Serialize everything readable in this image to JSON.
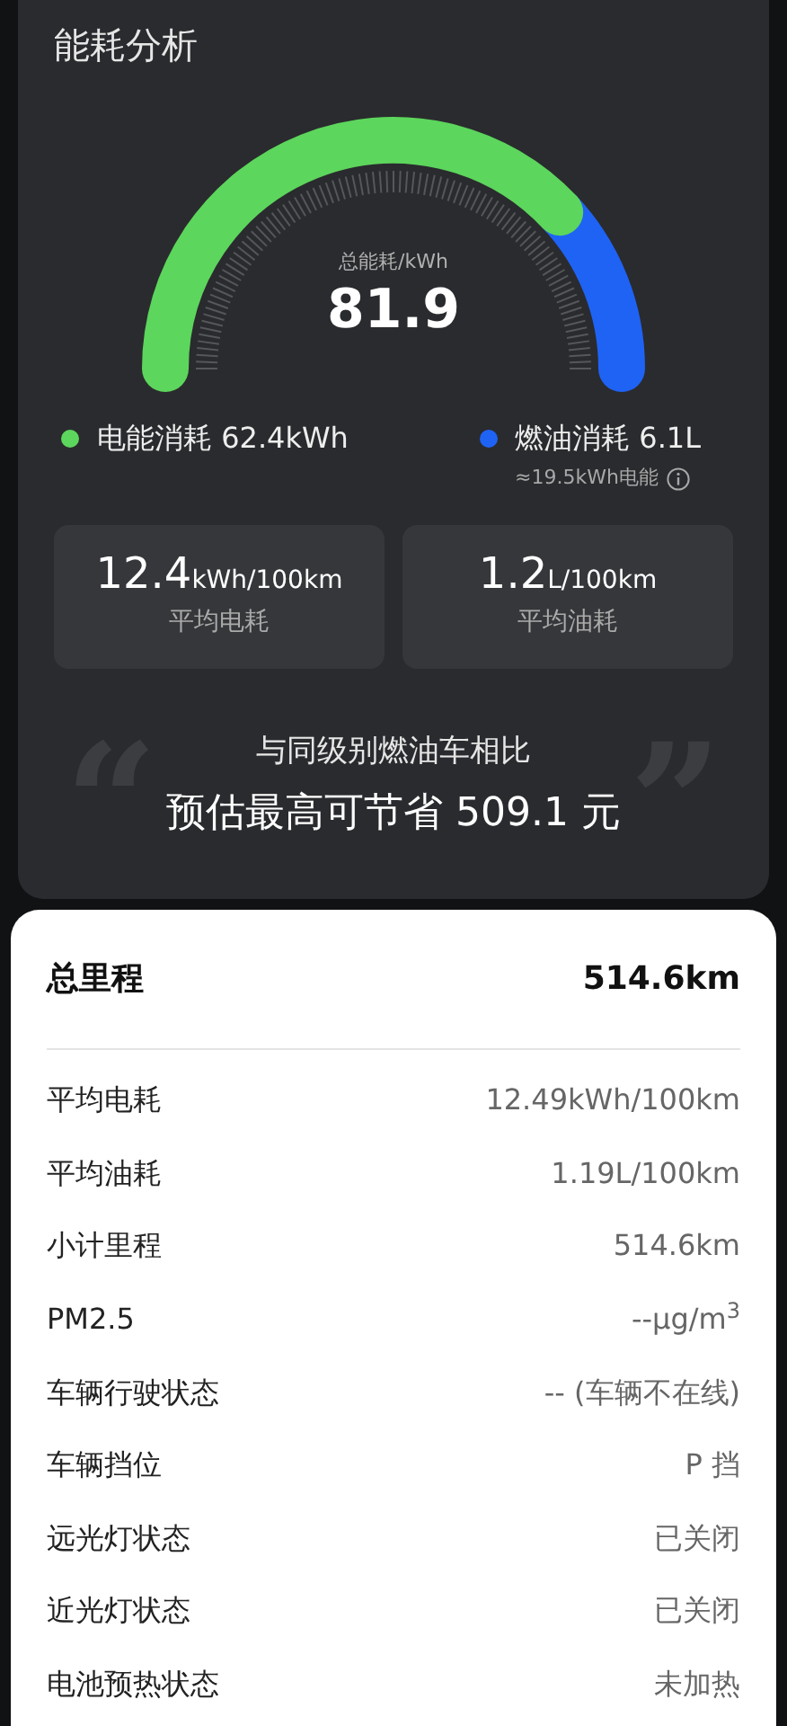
{
  "title": "能耗分析",
  "gauge": {
    "label": "总能耗/kWh",
    "value": "81.9"
  },
  "legend": [
    {
      "label": "电能消耗 62.4kWh",
      "color": "#5cd65c"
    },
    {
      "label": "燃油消耗 6.1L",
      "color": "#1f63f5",
      "note": "≈19.5kWh电能"
    }
  ],
  "stats": [
    {
      "value": "12.4",
      "unit": "kWh/100km",
      "label": "平均电耗"
    },
    {
      "value": "1.2",
      "unit": "L/100km",
      "label": "平均油耗"
    }
  ],
  "comparison": {
    "open_quote": "“",
    "line1": "与同级别燃油车相比",
    "line2": "预估最高可节省 509.1 元",
    "close_quote": "”"
  },
  "summary": {
    "label": "总里程",
    "value": "514.6km"
  },
  "details": [
    {
      "label": "平均电耗",
      "value": "12.49kWh/100km"
    },
    {
      "label": "平均油耗",
      "value": "1.19L/100km"
    },
    {
      "label": "小计里程",
      "value": "514.6km"
    },
    {
      "label": "PM2.5",
      "value": "--µg/m$^{3}$"
    },
    {
      "label": "车辆行驶状态",
      "value": "-- (车辆不在线)"
    },
    {
      "label": "车辆挡位",
      "value": "P 挡"
    },
    {
      "label": "远光灯状态",
      "value": "已关闭"
    },
    {
      "label": "近光灯状态",
      "value": "已关闭"
    },
    {
      "label": "电池预热状态",
      "value": "未加热"
    }
  ]
}
